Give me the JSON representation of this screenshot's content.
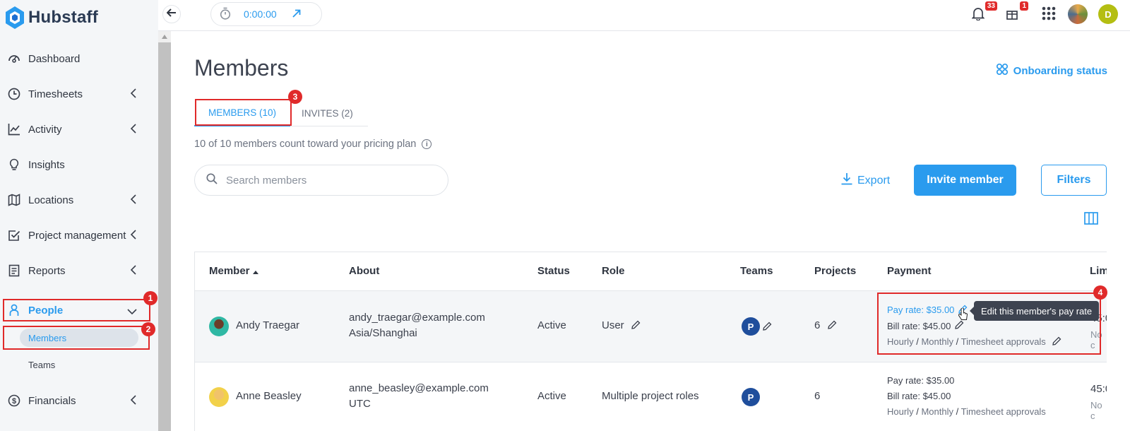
{
  "app": {
    "name": "Hubstaff"
  },
  "sidebar": {
    "items": [
      {
        "label": "Dashboard",
        "icon": "dashboard-icon",
        "chevron": false
      },
      {
        "label": "Timesheets",
        "icon": "clock-icon",
        "chevron": true
      },
      {
        "label": "Activity",
        "icon": "activity-chart-icon",
        "chevron": true
      },
      {
        "label": "Insights",
        "icon": "lightbulb-icon",
        "chevron": true,
        "hide_chevron": true
      },
      {
        "label": "Locations",
        "icon": "map-icon",
        "chevron": true
      },
      {
        "label": "Project management",
        "icon": "checkbox-icon",
        "chevron": true
      },
      {
        "label": "Reports",
        "icon": "report-icon",
        "chevron": true
      },
      {
        "label": "People",
        "icon": "person-icon",
        "chevron": true,
        "active": true
      },
      {
        "label": "Financials",
        "icon": "dollar-icon",
        "chevron": true
      }
    ],
    "people_sub": [
      {
        "label": "Members",
        "active": true
      },
      {
        "label": "Teams"
      }
    ]
  },
  "annotations": {
    "one": "1",
    "two": "2",
    "three": "3",
    "four": "4"
  },
  "topbar": {
    "timer": "0:00:00",
    "notifications_count": "33",
    "gifts_count": "1",
    "avatar_initial": "D"
  },
  "main": {
    "title": "Members",
    "onboarding": "Onboarding status",
    "tabs": [
      {
        "label": "MEMBERS (10)",
        "active": true
      },
      {
        "label": "INVITES (2)"
      }
    ],
    "plan_note": "10 of 10 members count toward your pricing plan",
    "search_placeholder": "Search members",
    "export_label": "Export",
    "invite_label": "Invite member",
    "filters_label": "Filters"
  },
  "table": {
    "headers": [
      "Member",
      "About",
      "Status",
      "Role",
      "Teams",
      "Projects",
      "Payment",
      "Lim"
    ],
    "rows": [
      {
        "name": "Andy Traegar",
        "email": "andy_traegar@example.com",
        "timezone": "Asia/Shanghai",
        "status": "Active",
        "role": "User",
        "team": "P",
        "projects": "6",
        "pay_rate": "Pay rate: $35.00",
        "bill_rate": "Bill rate: $45.00",
        "pay_modes": [
          "Hourly",
          "Monthly",
          "Timesheet approvals"
        ],
        "limit_top": "45:0",
        "limit_bottom": "No c"
      },
      {
        "name": "Anne Beasley",
        "email": "anne_beasley@example.com",
        "timezone": "UTC",
        "status": "Active",
        "role": "Multiple project roles",
        "team": "P",
        "projects": "6",
        "pay_rate": "Pay rate: $35.00",
        "bill_rate": "Bill rate: $45.00",
        "pay_modes": [
          "Hourly",
          "Monthly",
          "Timesheet approvals"
        ],
        "limit_top": "45:0",
        "limit_bottom": "No c"
      }
    ],
    "tooltip": "Edit this member's pay rate",
    "mode_separator": "/"
  },
  "colors": {
    "accent": "#2a9bee",
    "annotation": "#e02a2a",
    "team_badge": "#1f4e9c"
  }
}
